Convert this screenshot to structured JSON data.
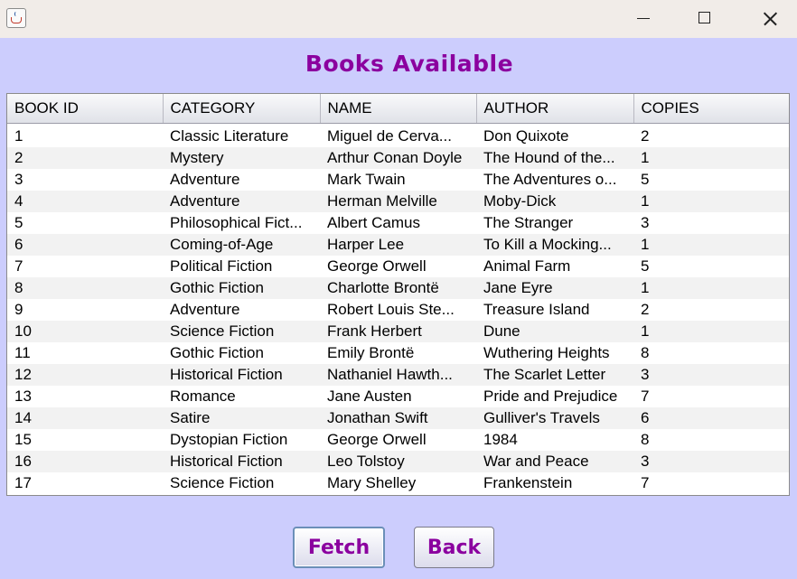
{
  "window": {
    "minimize_icon": "minimize-icon",
    "maximize_icon": "maximize-icon",
    "close_icon": "close-icon"
  },
  "heading": "Books Available",
  "table": {
    "columns": [
      "BOOK ID",
      "CATEGORY",
      "NAME",
      "AUTHOR",
      "COPIES"
    ],
    "rows": [
      [
        "1",
        "Classic Literature",
        "Miguel de Cerva...",
        "Don Quixote",
        "2"
      ],
      [
        "2",
        "Mystery",
        "Arthur Conan Doyle",
        "The Hound of the...",
        "1"
      ],
      [
        "3",
        "Adventure",
        "Mark Twain",
        "The Adventures o...",
        "5"
      ],
      [
        "4",
        "Adventure",
        "Herman Melville",
        "Moby-Dick",
        "1"
      ],
      [
        "5",
        "Philosophical Fict...",
        "Albert Camus",
        "The Stranger",
        "3"
      ],
      [
        "6",
        "Coming-of-Age",
        "Harper Lee",
        "To Kill a Mocking...",
        "1"
      ],
      [
        "7",
        "Political Fiction",
        "George Orwell",
        "Animal Farm",
        "5"
      ],
      [
        "8",
        "Gothic Fiction",
        "Charlotte Brontë",
        "Jane Eyre",
        "1"
      ],
      [
        "9",
        "Adventure",
        "Robert Louis Ste...",
        "Treasure Island",
        "2"
      ],
      [
        "10",
        "Science Fiction",
        "Frank Herbert",
        "Dune",
        "1"
      ],
      [
        "11",
        "Gothic Fiction",
        "Emily Brontë",
        "Wuthering Heights",
        "8"
      ],
      [
        "12",
        "Historical Fiction",
        "Nathaniel Hawth...",
        "The Scarlet Letter",
        "3"
      ],
      [
        "13",
        "Romance",
        "Jane Austen",
        "Pride and Prejudice",
        "7"
      ],
      [
        "14",
        "Satire",
        "Jonathan Swift",
        "Gulliver's Travels",
        "6"
      ],
      [
        "15",
        "Dystopian Fiction",
        "George Orwell",
        "1984",
        "8"
      ],
      [
        "16",
        "Historical Fiction",
        "Leo Tolstoy",
        "War and Peace",
        "3"
      ],
      [
        "17",
        "Science Fiction",
        "Mary Shelley",
        "Frankenstein",
        "7"
      ]
    ]
  },
  "buttons": {
    "fetch": "Fetch",
    "back": "Back"
  },
  "colors": {
    "background": "#cccdfd",
    "heading": "#8b009f",
    "titlebar": "#f1ece8"
  }
}
